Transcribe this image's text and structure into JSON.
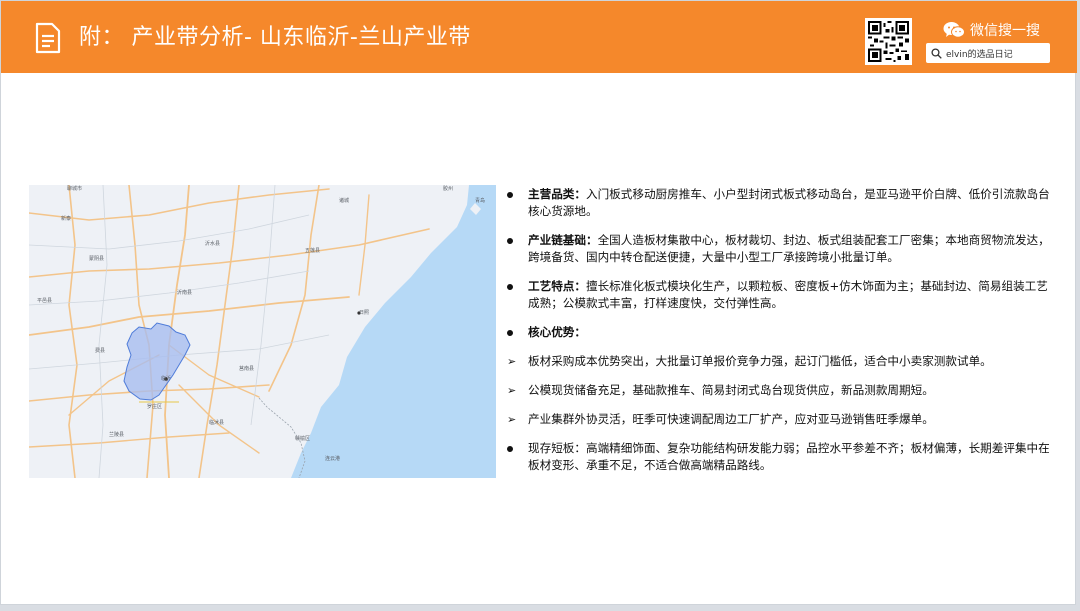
{
  "header": {
    "title": "附：  产业带分析- 山东临沂-兰山产业带",
    "wechat_label": "微信搜一搜",
    "search_text": "elvin的选品日记",
    "icons": {
      "document": "document-icon",
      "qr": "qr-code-icon",
      "wechat": "wechat-icon",
      "search": "search-icon"
    },
    "color": "#f5882b"
  },
  "map": {
    "highlight_color": "#a7bcef",
    "labels": {
      "l1": "聊城市",
      "l2": "新泰",
      "l3": "蒙阴县",
      "l4": "沂南县",
      "l5": "平邑县",
      "l6": "沂水县",
      "l7": "诸城",
      "l8": "五莲县",
      "l9": "日照",
      "l10": "费县",
      "l11": "临沂",
      "l12": "罗庄区",
      "l13": "莒南县",
      "l14": "临沭县",
      "l15": "兰陵县",
      "l16": "赣榆区",
      "l17": "连云港",
      "l18": "青岛",
      "l19": "胶州"
    }
  },
  "bullets": [
    {
      "type": "dot",
      "label": "主营品类：",
      "text": "入门板式移动厨房推车、小户型封闭式板式移动岛台，是亚马逊平价白牌、低价引流款岛台核心货源地。"
    },
    {
      "type": "dot",
      "label": "产业链基础：",
      "text": "全国人造板材集散中心，板材裁切、封边、板式组装配套工厂密集；本地商贸物流发达，跨境备货、国内中转仓配送便捷，大量中小型工厂承接跨境小批量订单。"
    },
    {
      "type": "dot",
      "label": "工艺特点：",
      "text": "擅长标准化板式模块化生产，以颗粒板、密度板+仿木饰面为主；基础封边、简易组装工艺成熟；公模款式丰富，打样速度快，交付弹性高。"
    },
    {
      "type": "dot",
      "label": "核心优势：",
      "text": ""
    },
    {
      "type": "arrow",
      "label": "",
      "text": "板材采购成本优势突出，大批量订单报价竞争力强，起订门槛低，适合中小卖家测款试单。"
    },
    {
      "type": "arrow",
      "label": "",
      "text": "公模现货储备充足，基础款推车、简易封闭式岛台现货供应，新品测款周期短。"
    },
    {
      "type": "arrow",
      "label": "",
      "text": "产业集群外协灵活，旺季可快速调配周边工厂扩产，应对亚马逊销售旺季爆单。"
    },
    {
      "type": "dot",
      "label": "",
      "text": "现存短板：高端精细饰面、复杂功能结构研发能力弱；品控水平参差不齐；板材偏薄，长期差评集中在板材变形、承重不足，不适合做高端精品路线。"
    }
  ]
}
